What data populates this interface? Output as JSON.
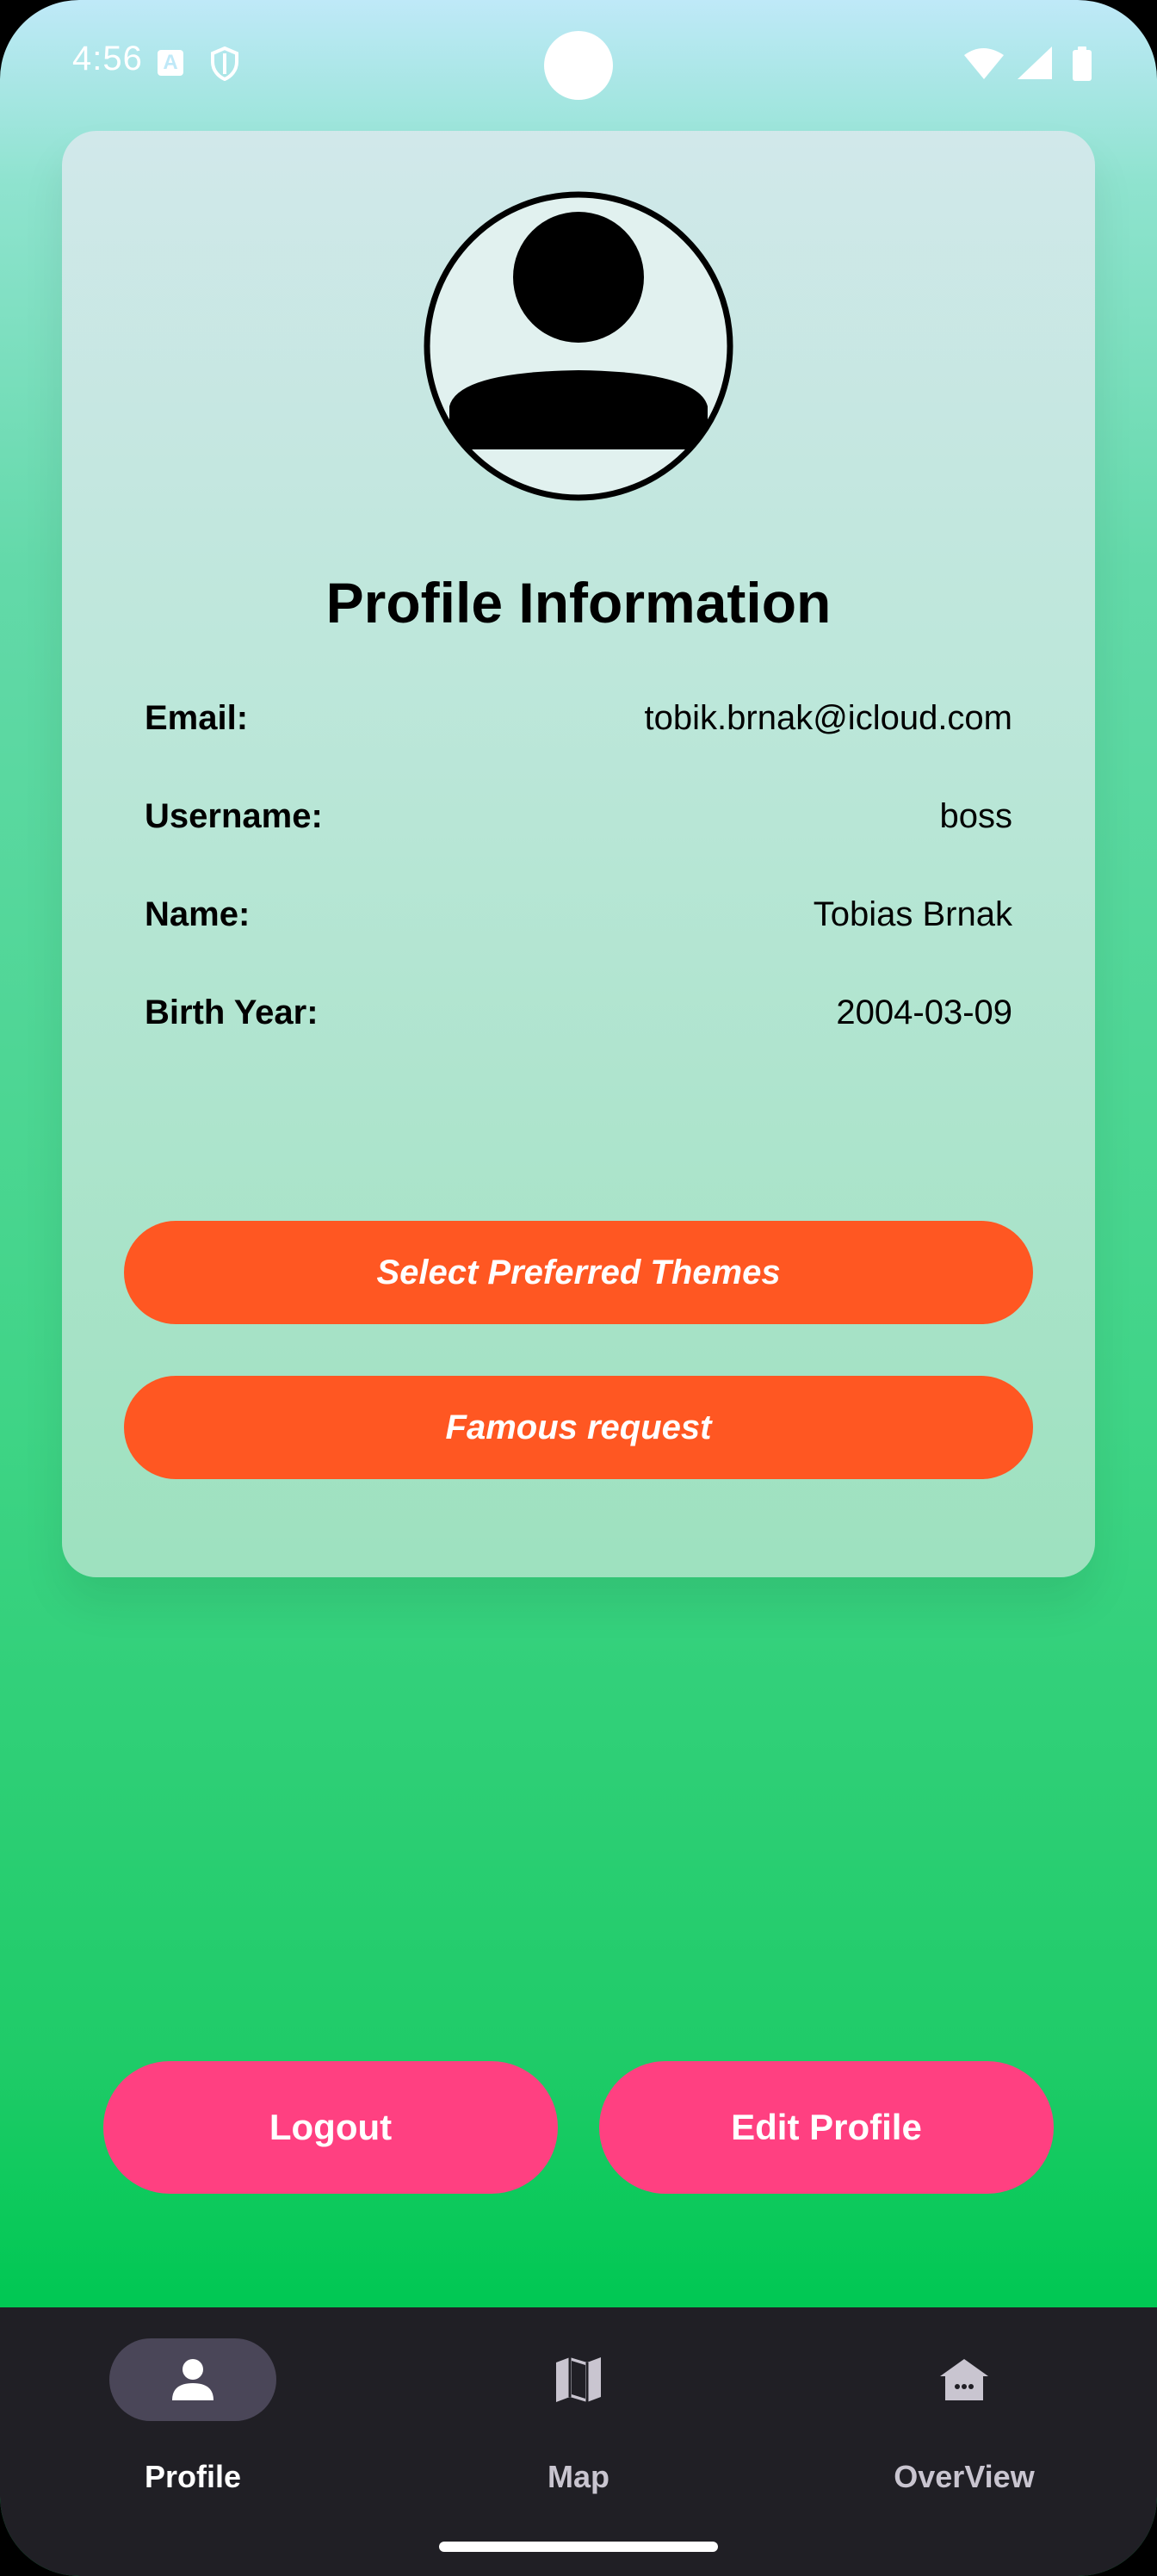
{
  "status_bar": {
    "time": "4:56",
    "icons": [
      "a-notification-icon",
      "shield-icon",
      "wifi-icon",
      "signal-icon",
      "battery-icon"
    ]
  },
  "profile_card": {
    "avatar_icon": "person-avatar-icon",
    "title": "Profile Information",
    "fields": [
      {
        "label": "Email:",
        "value": "tobik.brnak@icloud.com"
      },
      {
        "label": "Username:",
        "value": "boss"
      },
      {
        "label": "Name:",
        "value": "Tobias Brnak"
      },
      {
        "label": "Birth Year:",
        "value": "2004-03-09"
      }
    ],
    "select_themes_label": "Select Preferred Themes",
    "famous_request_label": "Famous request"
  },
  "actions": {
    "logout_label": "Logout",
    "edit_profile_label": "Edit Profile"
  },
  "bottom_nav": {
    "items": [
      {
        "label": "Profile",
        "icon": "person-icon",
        "active": true
      },
      {
        "label": "Map",
        "icon": "map-icon",
        "active": false
      },
      {
        "label": "OverView",
        "icon": "house-icon",
        "active": false
      }
    ]
  },
  "colors": {
    "orange_button": "#ff5722",
    "pink_button": "#ff4081",
    "nav_background": "#201f25",
    "nav_active_pill": "#4a4658"
  }
}
